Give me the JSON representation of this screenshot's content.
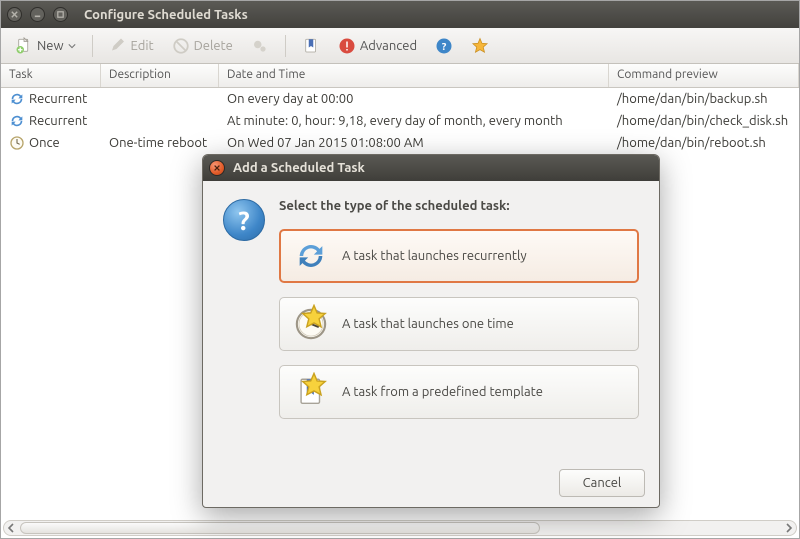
{
  "window": {
    "title": "Configure Scheduled Tasks"
  },
  "toolbar": {
    "new": "New",
    "edit": "Edit",
    "delete": "Delete",
    "advanced": "Advanced"
  },
  "columns": {
    "task": "Task",
    "description": "Description",
    "datetime": "Date and Time",
    "command": "Command preview"
  },
  "rows": [
    {
      "task": "Recurrent",
      "description": "",
      "datetime": "On every day at 00:00",
      "command": "/home/dan/bin/backup.sh"
    },
    {
      "task": "Recurrent",
      "description": "",
      "datetime": "At minute: 0, hour: 9,18, every day of month, every month",
      "command": "/home/dan/bin/check_disk.sh"
    },
    {
      "task": "Once",
      "description": "One-time reboot",
      "datetime": "On Wed 07 Jan 2015 01:08:00 AM",
      "command": "/home/dan/bin/reboot.sh"
    }
  ],
  "dialog": {
    "title": "Add a Scheduled Task",
    "heading": "Select the type of the scheduled task:",
    "opt_recurrent": "A task that launches recurrently",
    "opt_once": "A task that launches one time",
    "opt_template": "A task from a predefined template",
    "cancel": "Cancel"
  }
}
